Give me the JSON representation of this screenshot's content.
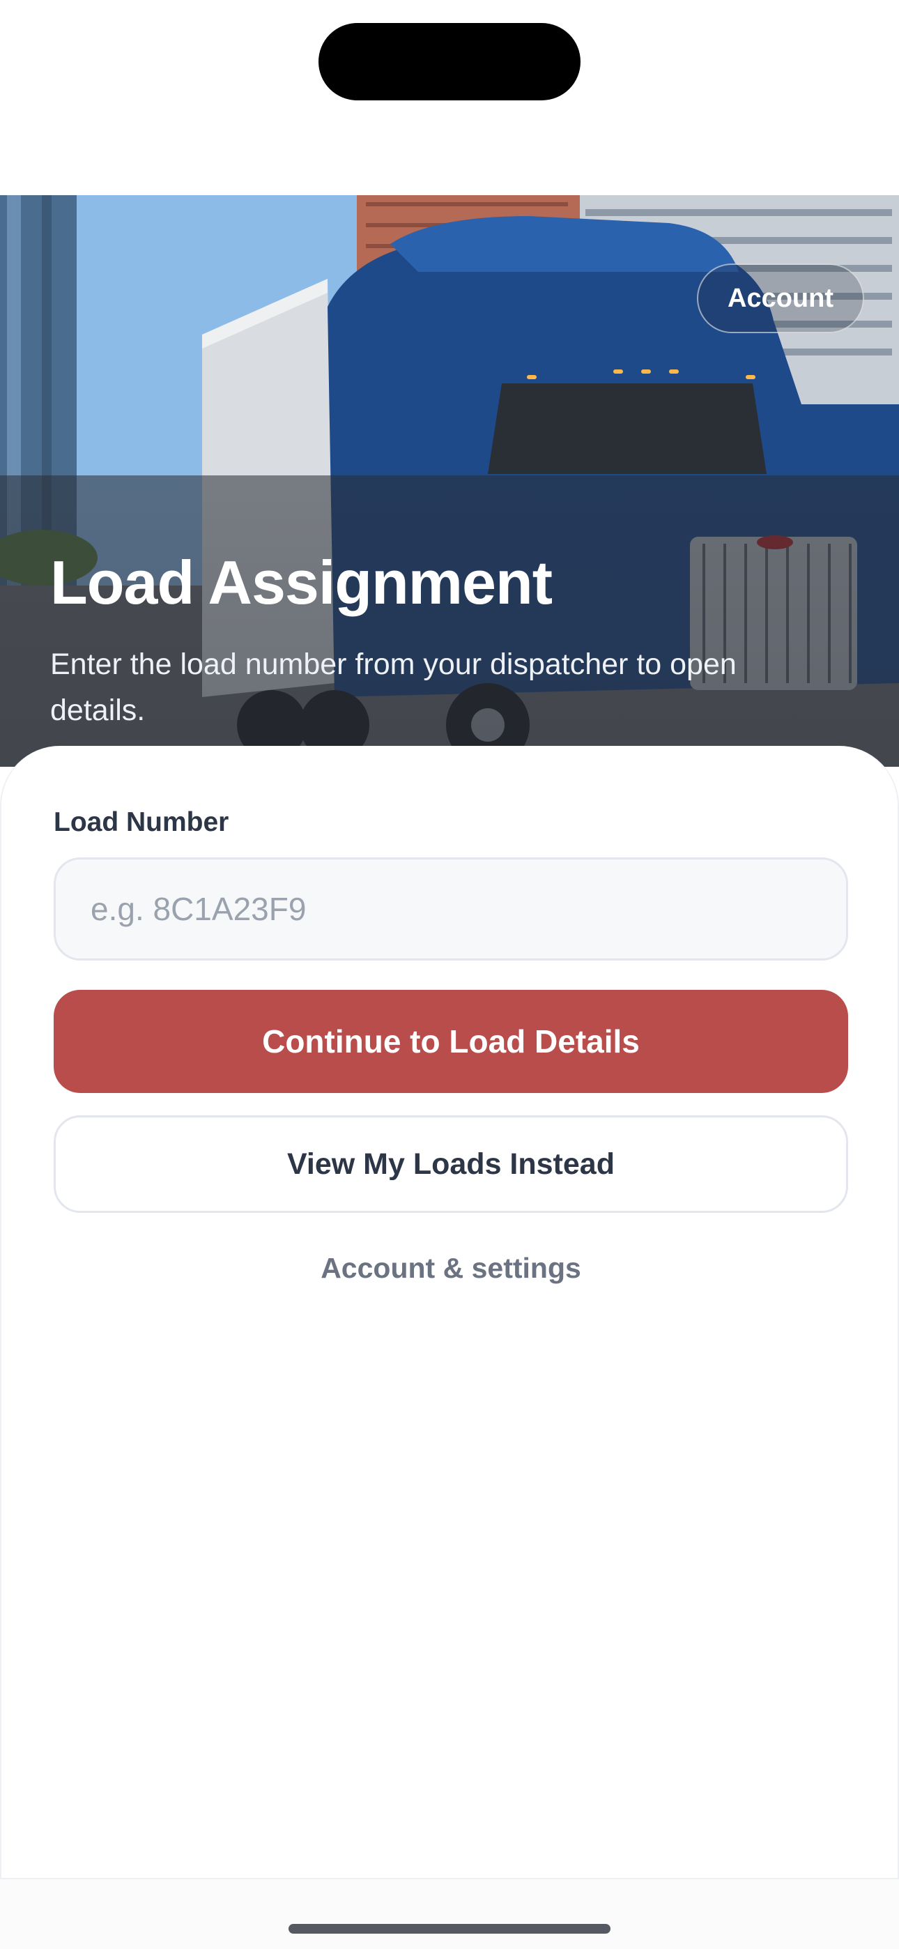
{
  "hero": {
    "account_label": "Account",
    "title": "Load Assignment",
    "subtitle": "Enter the load number from your dispatcher to open details.",
    "image": "truck-photo"
  },
  "form": {
    "load_number_label": "Load Number",
    "load_number_value": "",
    "load_number_placeholder": "e.g. 8C1A23F9",
    "continue_label": "Continue to Load Details",
    "view_loads_label": "View My Loads Instead",
    "settings_link": "Account & settings"
  },
  "colors": {
    "primary": "#b84d4b",
    "text_dark": "#2d3646",
    "text_muted": "#6b7383"
  }
}
